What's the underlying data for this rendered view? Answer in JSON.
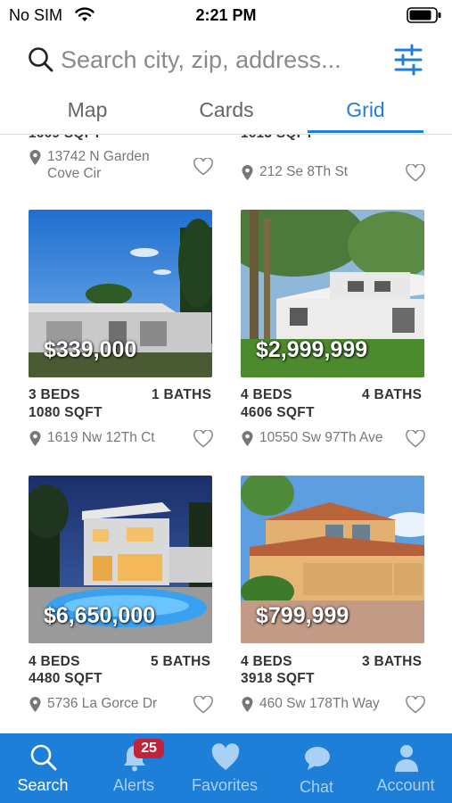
{
  "status": {
    "carrier": "No SIM",
    "time": "2:21 PM"
  },
  "search": {
    "placeholder": "Search city, zip, address..."
  },
  "tabs": [
    {
      "label": "Map",
      "active": false
    },
    {
      "label": "Cards",
      "active": false
    },
    {
      "label": "Grid",
      "active": true
    }
  ],
  "partial_row": {
    "left": {
      "address_line1": "13742 N Garden",
      "address_line2": "Cove Cir"
    },
    "right": {
      "address": "212 Se 8Th St"
    }
  },
  "listings": [
    {
      "price": "$339,000",
      "beds": "3 BEDS",
      "baths": "1 BATHS",
      "sqft": "1080 SQFT",
      "address": "1619 Nw 12Th Ct"
    },
    {
      "price": "$2,999,999",
      "beds": "4 BEDS",
      "baths": "4 BATHS",
      "sqft": "4606 SQFT",
      "address": "10550 Sw 97Th Ave"
    },
    {
      "price": "$6,650,000",
      "beds": "4 BEDS",
      "baths": "5 BATHS",
      "sqft": "4480 SQFT",
      "address": "5736 La Gorce Dr"
    },
    {
      "price": "$799,999",
      "beds": "4 BEDS",
      "baths": "3 BATHS",
      "sqft": "3918 SQFT",
      "address": "460 Sw 178Th Way"
    }
  ],
  "bottom_nav": [
    {
      "label": "Search",
      "icon": "search-icon",
      "active": true
    },
    {
      "label": "Alerts",
      "icon": "bell-icon",
      "badge": "25"
    },
    {
      "label": "Favorites",
      "icon": "heart-icon"
    },
    {
      "label": "Chat",
      "icon": "chat-icon"
    },
    {
      "label": "Account",
      "icon": "person-icon"
    }
  ],
  "colors": {
    "accent": "#1e7fd8",
    "badge": "#c0233a"
  }
}
